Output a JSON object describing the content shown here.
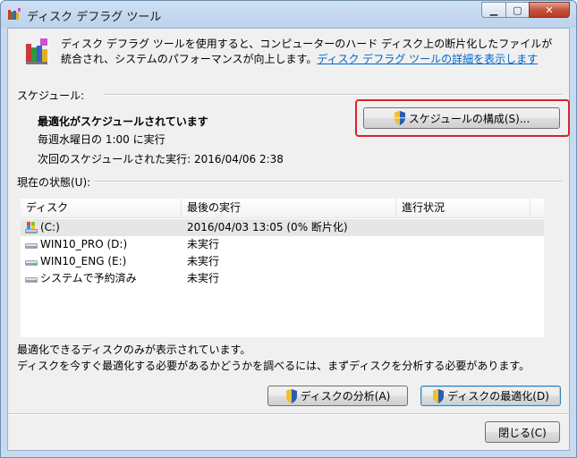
{
  "window": {
    "title": "ディスク デフラグ ツール"
  },
  "description": {
    "text": "ディスク デフラグ ツールを使用すると、コンピューターのハード ディスク上の断片化したファイルが統合され、システムのパフォーマンスが向上します。",
    "link": "ディスク デフラグ ツールの詳細を表示します"
  },
  "schedule": {
    "section_label": "スケジュール:",
    "status": "最適化がスケジュールされています",
    "frequency": "毎週水曜日の 1:00 に実行",
    "next_run": "次回のスケジュールされた実行: 2016/04/06 2:38",
    "configure_button": "スケジュールの構成(S)..."
  },
  "current_status": {
    "section_label": "現在の状態(U):",
    "columns": [
      "ディスク",
      "最後の実行",
      "進行状況"
    ],
    "rows": [
      {
        "disk": "(C:)",
        "last_run": "2016/04/03 13:05 (0% 断片化)",
        "progress": "",
        "icon": "system-drive-icon"
      },
      {
        "disk": "WIN10_PRO (D:)",
        "last_run": "未実行",
        "progress": "",
        "icon": "hard-drive-icon"
      },
      {
        "disk": "WIN10_ENG (E:)",
        "last_run": "未実行",
        "progress": "",
        "icon": "hard-drive-icon"
      },
      {
        "disk": "システムで予約済み",
        "last_run": "未実行",
        "progress": "",
        "icon": "hard-drive-icon"
      }
    ]
  },
  "footer": {
    "note1": "最適化できるディスクのみが表示されています。",
    "note2": "ディスクを今すぐ最適化する必要があるかどうかを調べるには、まずディスクを分析する必要があります。",
    "analyze_button": "ディスクの分析(A)",
    "defrag_button": "ディスクの最適化(D)",
    "close_button": "閉じる(C)"
  },
  "colors": {
    "highlight": "#d9232d",
    "link": "#0066cc"
  }
}
